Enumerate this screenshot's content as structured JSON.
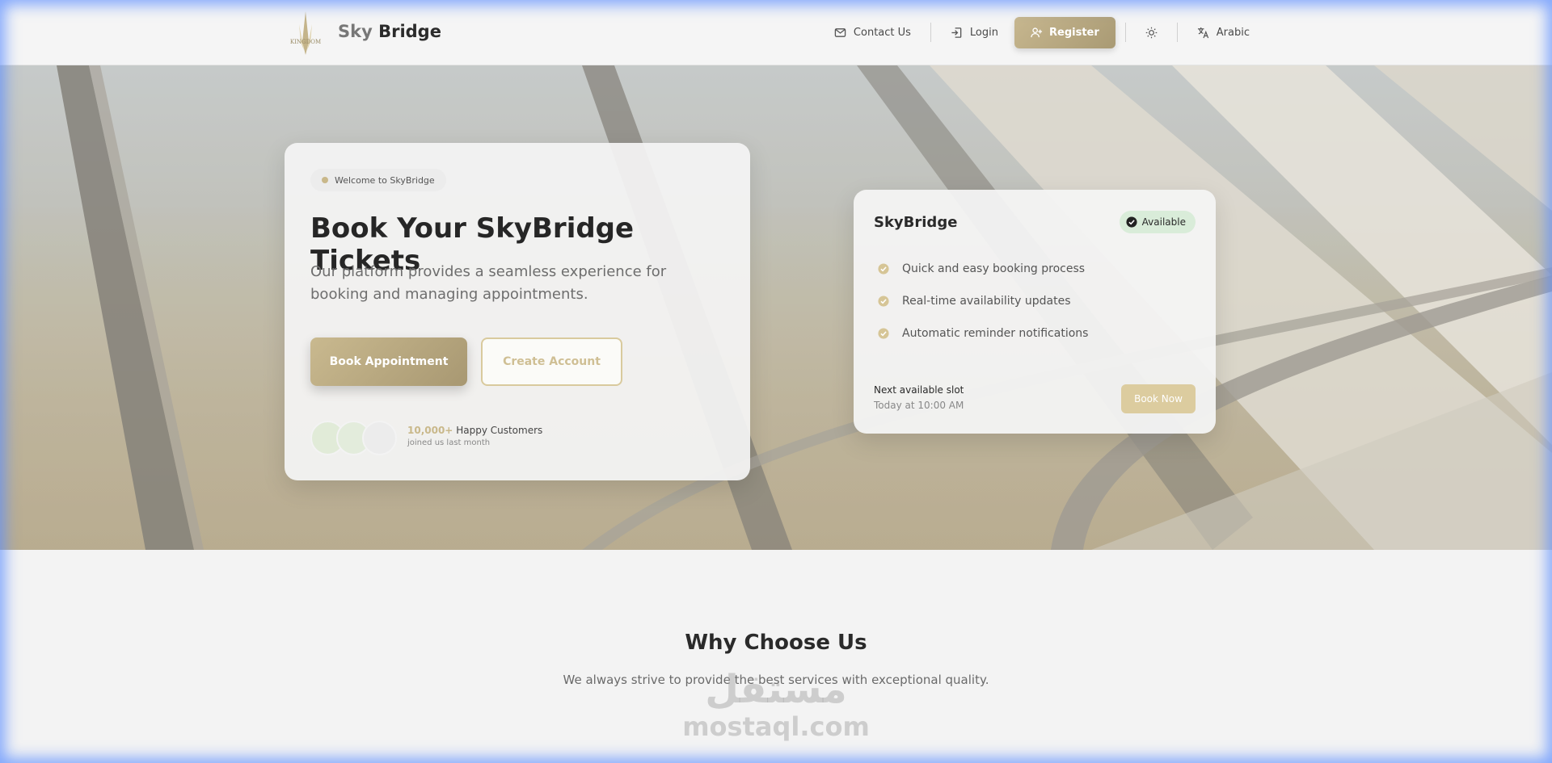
{
  "header": {
    "brand_part1": "Sky",
    "brand_part2": "Bridge",
    "logo_text": "KINGDOM",
    "nav": {
      "contact": "Contact Us",
      "login": "Login",
      "register": "Register",
      "language": "Arabic"
    }
  },
  "hero": {
    "welcome_pill": "Welcome to SkyBridge",
    "title": "Book Your SkyBridge Tickets",
    "description": "Our platform provides a seamless experience for booking and managing appointments.",
    "primary_button": "Book Appointment",
    "secondary_button": "Create Account",
    "customers_count": "10,000+",
    "customers_label": "Happy Customers",
    "customers_sub": "joined us last month"
  },
  "info_card": {
    "title": "SkyBridge",
    "badge": "Available",
    "features": [
      "Quick and easy booking process",
      "Real-time availability updates",
      "Automatic reminder notifications"
    ],
    "slot_label": "Next available slot",
    "slot_time": "Today at 10:00 AM",
    "book_button": "Book Now"
  },
  "why": {
    "title": "Why Choose Us",
    "subtitle": "We always strive to provide the best services with exceptional quality."
  },
  "watermark": {
    "arabic": "مستقل",
    "latin": "mostaql.com"
  },
  "colors": {
    "accent_gold": "#c9b88a",
    "available_badge": "#d9ecd9",
    "glow_frame": "#5a8cff"
  }
}
